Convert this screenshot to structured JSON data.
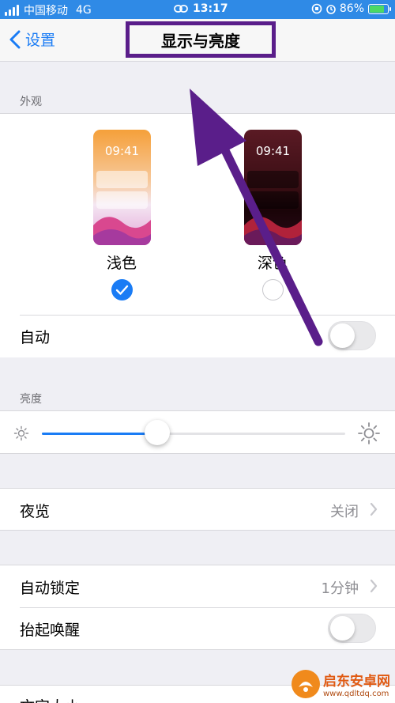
{
  "status_bar": {
    "carrier": "中国移动",
    "network": "4G",
    "time": "13:17",
    "battery": "86%",
    "battery_level": 0.86
  },
  "nav": {
    "back_label": "设置",
    "title": "显示与亮度"
  },
  "appearance": {
    "section_label": "外观",
    "light": {
      "label": "浅色",
      "time": "09:41",
      "selected": true
    },
    "dark": {
      "label": "深色",
      "time": "09:41",
      "selected": false
    },
    "auto_label": "自动",
    "auto_on": false
  },
  "brightness": {
    "section_label": "亮度",
    "level": 0.38
  },
  "night_shift": {
    "label": "夜览",
    "value": "关闭"
  },
  "auto_lock": {
    "label": "自动锁定",
    "value": "1分钟"
  },
  "raise_to_wake": {
    "label": "抬起唤醒",
    "on": false
  },
  "text_size": {
    "label": "文字大小"
  },
  "watermark": {
    "name": "启东安卓网",
    "url": "www.qdltdq.com"
  },
  "colors": {
    "accent": "#1a7cf5",
    "status_bar": "#2f8ae6",
    "annotation": "#5a1e8a"
  }
}
